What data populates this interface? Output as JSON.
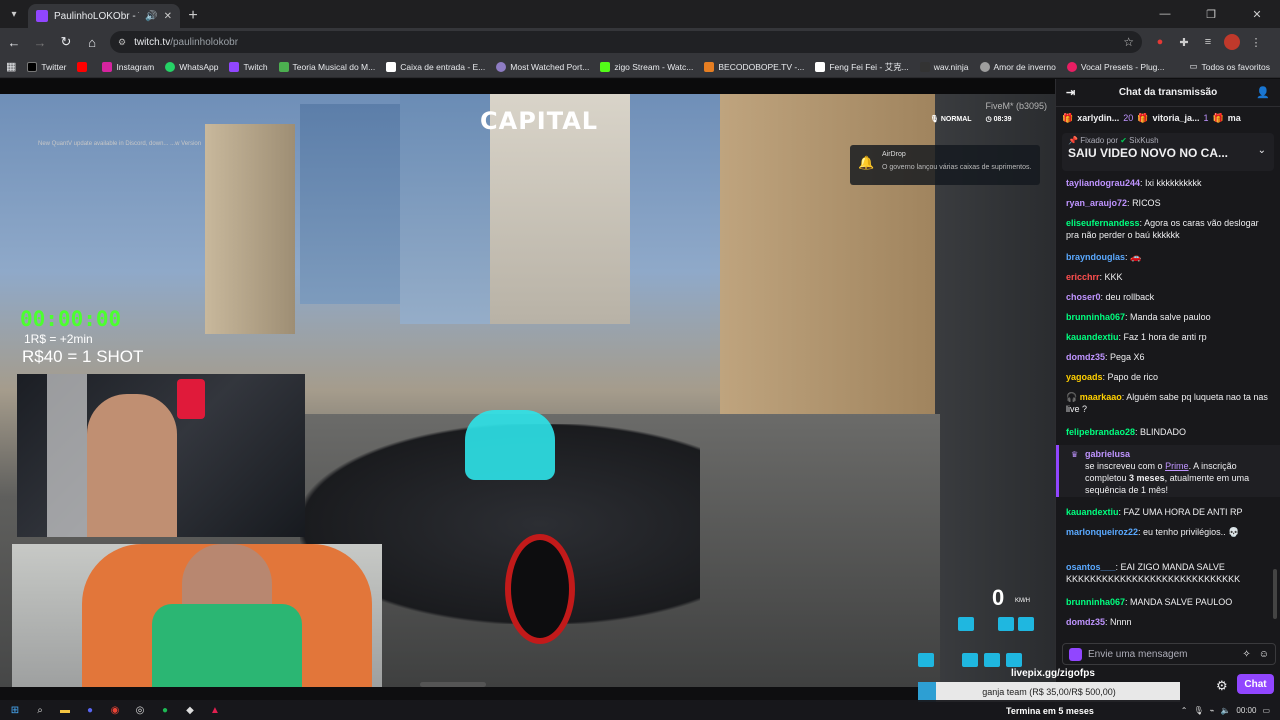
{
  "browser": {
    "tab_title": "PaulinhoLOKObr - Twitch",
    "url_host": "twitch.tv",
    "url_path": "/paulinholokobr",
    "bookmarks": [
      {
        "label": "Twitter",
        "color": "#1d1d1d"
      },
      {
        "label": "",
        "color": "#ff0000"
      },
      {
        "label": "Instagram",
        "color": "#d6249f"
      },
      {
        "label": "WhatsApp",
        "color": "#25d366"
      },
      {
        "label": "Twitch",
        "color": "#9146ff"
      },
      {
        "label": "Teoria Musical do M...",
        "color": "#4caf50"
      },
      {
        "label": "Caixa de entrada - E...",
        "color": "#ffffff"
      },
      {
        "label": "Most Watched Port...",
        "color": "#8e7cc3"
      },
      {
        "label": "zigo Stream - Watc...",
        "color": "#53fc18"
      },
      {
        "label": "BECODOBOPE.TV -...",
        "color": "#e67e22"
      },
      {
        "label": "Feng Fei Fei - 艾克...",
        "color": "#ffffff"
      },
      {
        "label": "wav.ninja",
        "color": "#333333"
      },
      {
        "label": "Amor de inverno",
        "color": "#9e9e9e"
      },
      {
        "label": "Vocal Presets - Plug...",
        "color": "#e91e63"
      }
    ],
    "all_favorites": "Todos os favoritos"
  },
  "stream": {
    "hud_notice": "New QuantV update available in Discord, down... ...w Version",
    "server_logo": "CAPITAL",
    "fivem_tag": "FiveM* (b3095)",
    "voice_mode": "NORMAL",
    "clock": "08:39",
    "notification_title": "AirDrop",
    "notification_body": "O governo lançou várias caixas de suprimentos.",
    "timer": "00:00:00",
    "rate": "1R$ = +2min",
    "shot": "R$40 = 1 SHOT",
    "speed": "0",
    "speed_unit": "KM/H",
    "livepix": "livepix.gg/zigofps",
    "goal_text": "ganja team (R$ 35,00/R$ 500,00)",
    "goal_progress": 0.07,
    "ends": "Termina em 5 meses"
  },
  "chat": {
    "header": "Chat da transmissão",
    "leaders": [
      {
        "name": "xarlydin...",
        "count": "20"
      },
      {
        "name": "vitoria_ja...",
        "count": "1"
      },
      {
        "name": "ma",
        "count": ""
      }
    ],
    "pinned_by_prefix": "Fixado por",
    "pinned_by": "SixKush",
    "pinned_message": "SAIU VIDEO NOVO NO CA...",
    "messages": [
      {
        "user": "tayliandograu244",
        "color": "#bf94ff",
        "text": "Ixi kkkkkkkkkk"
      },
      {
        "user": "ryan_araujo72",
        "color": "#bf94ff",
        "text": "RICOS"
      },
      {
        "user": "eliseufernandess",
        "color": "#00ff7f",
        "text": "Agora os caras vão deslogar pra não perder o baú kkkkkk"
      },
      {
        "user": "brayndouglas",
        "color": "#5aa9ff",
        "text": "🚗"
      },
      {
        "user": "ericchrr",
        "color": "#ff4f4f",
        "text": "KKK"
      },
      {
        "user": "choser0",
        "color": "#bf94ff",
        "text": "deu rollback"
      },
      {
        "user": "brunninha067",
        "color": "#00ff7f",
        "text": "Manda salve pauloo"
      },
      {
        "user": "kauandextiu",
        "color": "#00ff7f",
        "text": "Faz 1 hora de anti rp"
      },
      {
        "user": "domdz35",
        "color": "#bf94ff",
        "text": "Pega X6"
      },
      {
        "user": "yagoads",
        "color": "#ffd000",
        "text": "Papo de rico"
      },
      {
        "user": "maarkaao",
        "color": "#ffd000",
        "text": "Alguém sabe pq luqueta nao ta nas live ?"
      },
      {
        "user": "felipebrandao28",
        "color": "#00ff7f",
        "text": "BLINDADO"
      },
      {
        "user": "kauandextiu",
        "color": "#00ff7f",
        "text": "FAZ UMA HORA DE ANTI RP"
      },
      {
        "user": "marlonqueiroz22",
        "color": "#5aa9ff",
        "text": "eu tenho privilégios.. 💀"
      },
      {
        "user": "osantos___",
        "color": "#5aa9ff",
        "text": "EAI ZIGO MANDA SALVE KKKKKKKKKKKKKKKKKKKKKKKKKKKKK"
      },
      {
        "user": "brunninha067",
        "color": "#00ff7f",
        "text": "MANDA SALVE PAULOO"
      },
      {
        "user": "domdz35",
        "color": "#bf94ff",
        "text": "Nnnn"
      }
    ],
    "sub": {
      "user": "gabrielusa",
      "line1": "se inscreveu com o",
      "prime": "Prime",
      "line2": ". A inscrição completou",
      "months": "3 meses",
      "line3": ", atualmente em uma sequência de 1 mês!"
    },
    "input_placeholder": "Envie uma mensagem",
    "chat_button": "Chat"
  },
  "taskbar": {
    "time": "00:00"
  }
}
